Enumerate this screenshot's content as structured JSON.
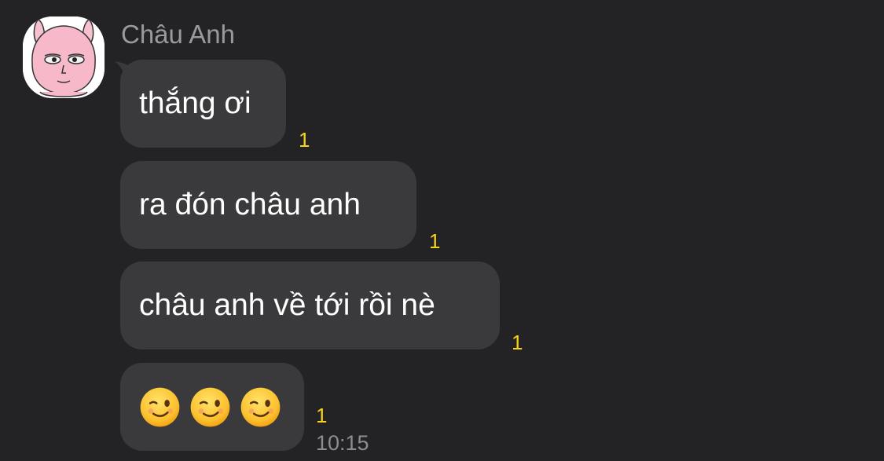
{
  "contact": {
    "name": "Châu Anh",
    "avatar": "pink-bunny-avatar"
  },
  "messages": [
    {
      "text": "thắng ơi",
      "unread_count": "1"
    },
    {
      "text": "ra đón châu anh",
      "unread_count": "1"
    },
    {
      "text": "châu anh về tới rồi nè",
      "unread_count": "1"
    },
    {
      "emojis": [
        "winking-face",
        "winking-face",
        "winking-face"
      ],
      "unread_count": "1",
      "time": "10:15"
    }
  ],
  "colors": {
    "background": "#232325",
    "bubble": "#3a3a3c",
    "bubble_text": "#ffffff",
    "sender_name": "#9a9a9d",
    "unread_count": "#f7d417",
    "timestamp": "#8d8d90"
  }
}
